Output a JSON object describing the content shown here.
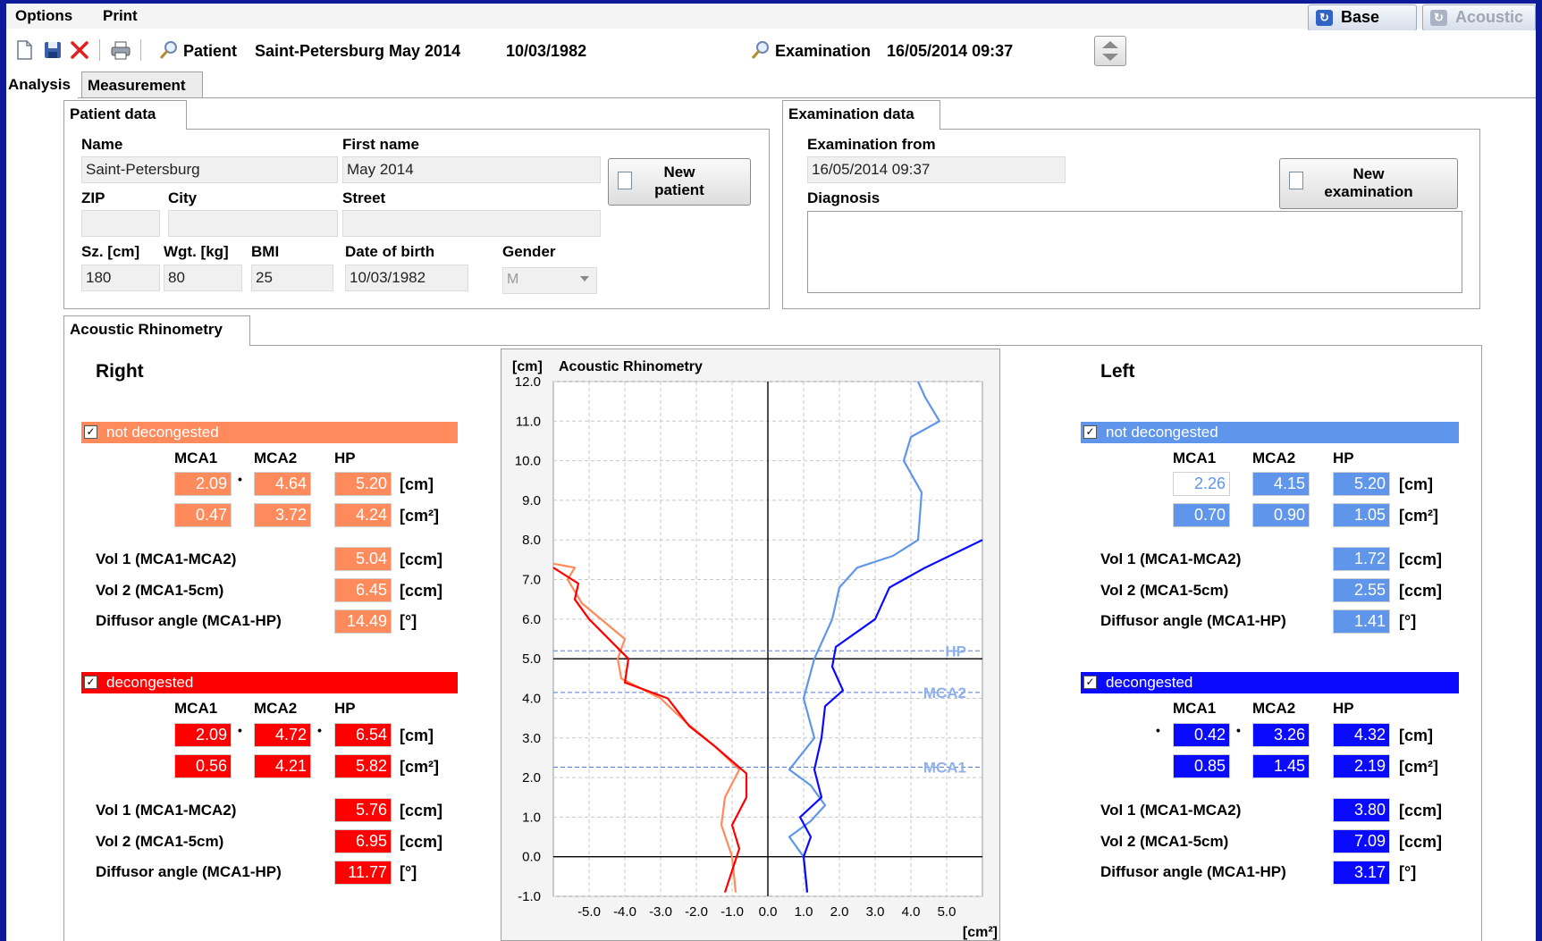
{
  "menu": {
    "options": "Options",
    "print": "Print",
    "base": "Base",
    "acoustic": "Acoustic"
  },
  "toolbar": {
    "patient_label": "Patient",
    "patient_name": "Saint-Petersburg May 2014",
    "patient_dob": "10/03/1982",
    "examination_label": "Examination",
    "examination_date": "16/05/2014 09:37"
  },
  "tabs": {
    "analysis": "Analysis",
    "measurement": "Measurement"
  },
  "patient_data": {
    "title": "Patient data",
    "name_label": "Name",
    "name": "Saint-Petersburg",
    "first_name_label": "First name",
    "first_name": "May 2014",
    "zip_label": "ZIP",
    "zip": "",
    "city_label": "City",
    "city": "",
    "street_label": "Street",
    "street": "",
    "size_label": "Sz. [cm]",
    "size": "180",
    "weight_label": "Wgt. [kg]",
    "weight": "80",
    "bmi_label": "BMI",
    "bmi": "25",
    "dob_label": "Date of birth",
    "dob": "10/03/1982",
    "gender_label": "Gender",
    "gender": "M",
    "new_patient_line1": "New",
    "new_patient_line2": "patient"
  },
  "examination_data": {
    "title": "Examination data",
    "exam_from_label": "Examination from",
    "exam_from": "16/05/2014 09:37",
    "diagnosis_label": "Diagnosis",
    "diagnosis": "",
    "new_exam_line1": "New",
    "new_exam_line2": "examination"
  },
  "acoustic": {
    "tab": "Acoustic Rhinometry",
    "col_mca1": "MCA1",
    "col_mca2": "MCA2",
    "col_hp": "HP",
    "unit_cm": "[cm]",
    "unit_cm2": "[cm²]",
    "unit_ccm": "[ccm]",
    "unit_deg": "[°]",
    "vol1_label": "Vol 1 (MCA1-MCA2)",
    "vol2_label": "Vol 2 (MCA1-5cm)",
    "diff_label": "Diffusor angle (MCA1-HP)",
    "right": {
      "title": "Right",
      "nd": {
        "header": "not decongested",
        "mca1_cm": "2.09",
        "mca2_cm": "4.64",
        "hp_cm": "5.20",
        "mca1_cm2": "0.47",
        "mca2_cm2": "3.72",
        "hp_cm2": "4.24",
        "vol1": "5.04",
        "vol2": "6.45",
        "diff": "14.49"
      },
      "d": {
        "header": "decongested",
        "mca1_cm": "2.09",
        "mca2_cm": "4.72",
        "hp_cm": "6.54",
        "mca1_cm2": "0.56",
        "mca2_cm2": "4.21",
        "hp_cm2": "5.82",
        "vol1": "5.76",
        "vol2": "6.95",
        "diff": "11.77"
      }
    },
    "left": {
      "title": "Left",
      "nd": {
        "header": "not decongested",
        "mca1_cm": "2.26",
        "mca2_cm": "4.15",
        "hp_cm": "5.20",
        "mca1_cm2": "0.70",
        "mca2_cm2": "0.90",
        "hp_cm2": "1.05",
        "vol1": "1.72",
        "vol2": "2.55",
        "diff": "1.41"
      },
      "d": {
        "header": "decongested",
        "mca1_cm": "0.42",
        "mca2_cm": "3.26",
        "hp_cm": "4.32",
        "mca1_cm2": "0.85",
        "mca2_cm2": "1.45",
        "hp_cm2": "2.19",
        "vol1": "3.80",
        "vol2": "7.09",
        "diff": "3.17"
      }
    },
    "colors": {
      "right_nd": "#ff8a5c",
      "right_d": "#ff0000",
      "left_nd": "#5f95ea",
      "left_d": "#0a0aff"
    }
  },
  "chart_data": {
    "type": "line",
    "title": "Acoustic Rhinometry",
    "ylabel": "[cm]",
    "xlabel": "[cm²]",
    "xlim": [
      -6,
      6
    ],
    "ylim": [
      -1,
      12
    ],
    "xticks": [
      "-5.0",
      "-4.0",
      "-3.0",
      "-2.0",
      "-1.0",
      "0.0",
      "1.0",
      "2.0",
      "3.0",
      "4.0",
      "5.0"
    ],
    "yticks": [
      "-1.0",
      "0.0",
      "1.0",
      "2.0",
      "3.0",
      "4.0",
      "5.0",
      "6.0",
      "7.0",
      "8.0",
      "9.0",
      "10.0",
      "11.0",
      "12.0"
    ],
    "reference_lines": [
      {
        "label": "HP",
        "y": 5.2
      },
      {
        "label": "MCA2",
        "y": 4.15
      },
      {
        "label": "MCA1",
        "y": 2.26
      }
    ],
    "series": [
      {
        "color": "#ff8a5c",
        "points": [
          [
            -0.9,
            -0.9
          ],
          [
            -1.0,
            0.0
          ],
          [
            -1.3,
            0.8
          ],
          [
            -1.2,
            1.5
          ],
          [
            -0.8,
            2.2
          ],
          [
            -1.5,
            2.8
          ],
          [
            -2.3,
            3.4
          ],
          [
            -3.0,
            4.0
          ],
          [
            -4.1,
            4.5
          ],
          [
            -4.2,
            5.0
          ],
          [
            -4.0,
            5.5
          ],
          [
            -5.2,
            6.4
          ],
          [
            -5.6,
            7.0
          ],
          [
            -5.4,
            7.3
          ],
          [
            -6.0,
            7.4
          ]
        ]
      },
      {
        "color": "#ff0000",
        "points": [
          [
            -1.2,
            -0.9
          ],
          [
            -0.8,
            0.2
          ],
          [
            -1.0,
            0.8
          ],
          [
            -0.6,
            1.5
          ],
          [
            -0.6,
            2.1
          ],
          [
            -1.5,
            2.8
          ],
          [
            -2.2,
            3.3
          ],
          [
            -2.8,
            4.0
          ],
          [
            -4.0,
            4.4
          ],
          [
            -3.9,
            5.0
          ],
          [
            -5.0,
            6.0
          ],
          [
            -5.4,
            6.5
          ],
          [
            -5.3,
            6.9
          ],
          [
            -6.0,
            7.3
          ]
        ]
      },
      {
        "color": "#5f95ea",
        "points": [
          [
            1.1,
            -0.9
          ],
          [
            1.0,
            0.0
          ],
          [
            0.6,
            0.5
          ],
          [
            1.2,
            0.9
          ],
          [
            1.6,
            1.3
          ],
          [
            1.2,
            1.8
          ],
          [
            0.6,
            2.2
          ],
          [
            1.3,
            3.0
          ],
          [
            1.0,
            4.0
          ],
          [
            1.3,
            5.0
          ],
          [
            1.8,
            6.0
          ],
          [
            2.0,
            6.8
          ],
          [
            2.5,
            7.3
          ],
          [
            3.5,
            7.6
          ],
          [
            4.2,
            8.0
          ],
          [
            4.3,
            9.2
          ],
          [
            3.8,
            10.0
          ],
          [
            4.0,
            10.6
          ],
          [
            4.8,
            11.0
          ],
          [
            4.4,
            11.6
          ],
          [
            4.2,
            12.0
          ]
        ]
      },
      {
        "color": "#0a0aff",
        "points": [
          [
            1.1,
            -0.9
          ],
          [
            1.0,
            0.0
          ],
          [
            1.2,
            0.5
          ],
          [
            0.9,
            1.0
          ],
          [
            1.5,
            1.5
          ],
          [
            1.3,
            2.2
          ],
          [
            1.5,
            3.0
          ],
          [
            1.6,
            3.8
          ],
          [
            2.1,
            4.2
          ],
          [
            1.8,
            4.8
          ],
          [
            1.9,
            5.3
          ],
          [
            3.0,
            6.0
          ],
          [
            3.4,
            6.8
          ],
          [
            4.4,
            7.3
          ],
          [
            6.0,
            8.0
          ]
        ]
      }
    ]
  }
}
